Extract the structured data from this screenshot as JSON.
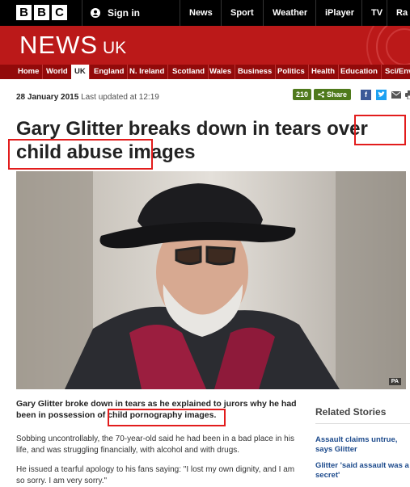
{
  "masthead": {
    "logo_letters": [
      "B",
      "B",
      "C"
    ],
    "signin_label": "Sign in",
    "nav": [
      "News",
      "Sport",
      "Weather",
      "iPlayer",
      "TV",
      "Ra"
    ]
  },
  "section_header": {
    "title": "NEWS",
    "subtitle": "UK"
  },
  "subnav": {
    "items": [
      "Home",
      "World",
      "UK",
      "England",
      "N. Ireland",
      "Scotland",
      "Wales",
      "Business",
      "Politics",
      "Health",
      "Education",
      "Sci/Env"
    ],
    "active": "UK"
  },
  "article": {
    "date": "28 January 2015",
    "updated": "Last updated at 12:19",
    "share_count": "210",
    "share_label": "Share",
    "headline": "Gary Glitter breaks down in tears over child abuse images",
    "photo_credit": "PA",
    "lead": "Gary Glitter broke down in tears as he explained to jurors why he had been in possession of child pornography images.",
    "paragraphs": [
      "Sobbing uncontrollably, the 70-year-old said he had been in a bad place in his life, and was struggling financially, with alcohol and with drugs.",
      "He issued a tearful apology to his fans saying: \"I lost my own dignity, and I am so sorry. I am very sorry.\""
    ]
  },
  "related": {
    "title": "Related Stories",
    "items": [
      "Assault claims untrue, says Glitter",
      "Glitter 'said assault was a secret'"
    ]
  },
  "colors": {
    "brand_red": "#bb1919",
    "dark_red": "#920a0a",
    "share_green": "#4f7a1c",
    "link_blue": "#1c4a8c",
    "highlight_box": "#e21c1c"
  },
  "icons": [
    "user-icon",
    "share-icon",
    "facebook-icon",
    "twitter-icon",
    "email-icon",
    "print-icon"
  ]
}
